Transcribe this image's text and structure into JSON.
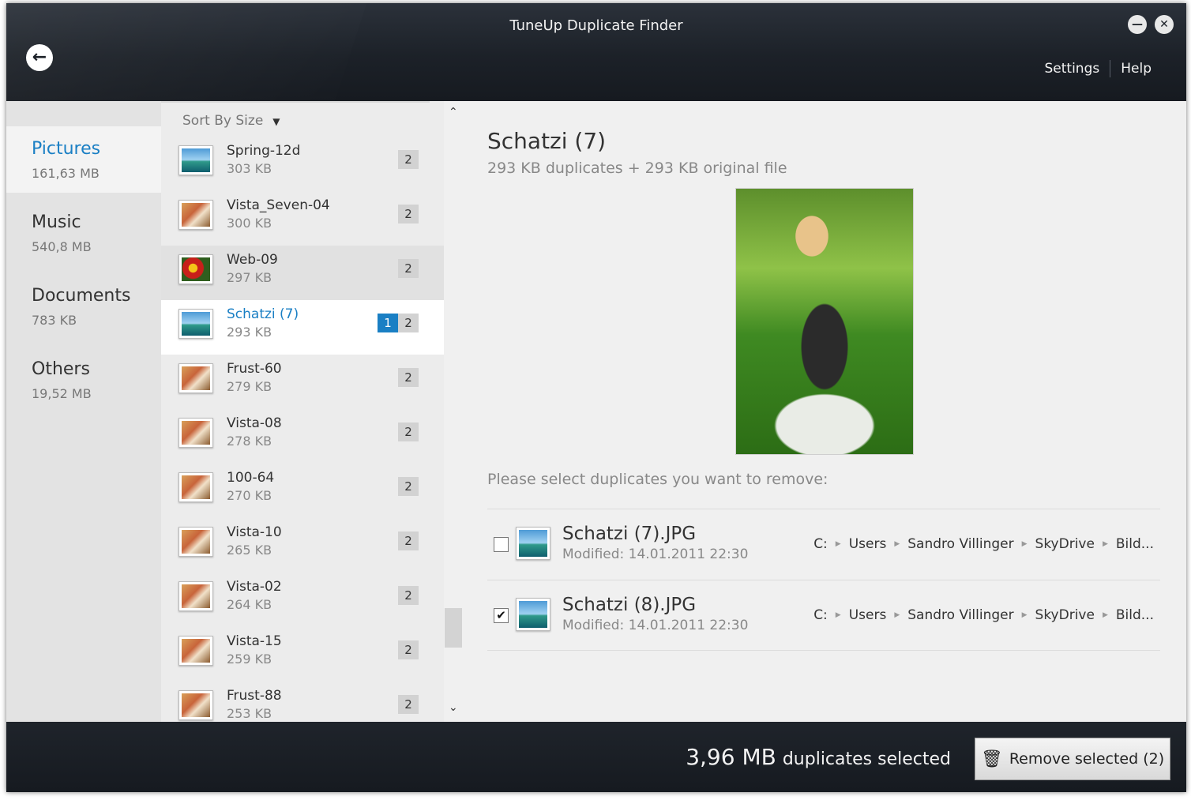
{
  "window": {
    "title": "TuneUp Duplicate Finder",
    "settings_label": "Settings",
    "help_label": "Help",
    "minimize_symbol": "—",
    "close_symbol": "✕",
    "back_symbol": "←"
  },
  "categories": [
    {
      "name": "Pictures",
      "size": "161,63 MB",
      "active": true
    },
    {
      "name": "Music",
      "size": "540,8 MB",
      "active": false
    },
    {
      "name": "Documents",
      "size": "783 KB",
      "active": false
    },
    {
      "name": "Others",
      "size": "19,52 MB",
      "active": false
    }
  ],
  "file_list": {
    "sort_label": "Sort By Size",
    "sort_arrow": "▼",
    "files": [
      {
        "name": "Spring-12d",
        "size": "303 KB",
        "count": "2",
        "selected_count": "",
        "icon": "landscape-icon"
      },
      {
        "name": "Vista_Seven-04",
        "size": "300 KB",
        "count": "2",
        "selected_count": "",
        "icon": "photo-icon"
      },
      {
        "name": "Web-09",
        "size": "297 KB",
        "count": "2",
        "selected_count": "",
        "icon": "flower-icon"
      },
      {
        "name": "Schatzi (7)",
        "size": "293 KB",
        "count": "2",
        "selected_count": "1",
        "icon": "landscape-icon"
      },
      {
        "name": "Frust-60",
        "size": "279 KB",
        "count": "2",
        "selected_count": "",
        "icon": "photo-icon"
      },
      {
        "name": "Vista-08",
        "size": "278 KB",
        "count": "2",
        "selected_count": "",
        "icon": "photo-icon"
      },
      {
        "name": "100-64",
        "size": "270 KB",
        "count": "2",
        "selected_count": "",
        "icon": "photo-icon"
      },
      {
        "name": "Vista-10",
        "size": "265 KB",
        "count": "2",
        "selected_count": "",
        "icon": "photo-icon"
      },
      {
        "name": "Vista-02",
        "size": "264 KB",
        "count": "2",
        "selected_count": "",
        "icon": "photo-icon"
      },
      {
        "name": "Vista-15",
        "size": "259 KB",
        "count": "2",
        "selected_count": "",
        "icon": "photo-icon"
      },
      {
        "name": "Frust-88",
        "size": "253 KB",
        "count": "2",
        "selected_count": "",
        "icon": "photo-icon"
      }
    ],
    "scroll_up": "⌃",
    "scroll_down": "⌄"
  },
  "detail": {
    "title": "Schatzi (7)",
    "subtitle": "293 KB duplicates + 293 KB original file",
    "prompt": "Please select duplicates you want to remove:",
    "duplicates": [
      {
        "name": "Schatzi (7).JPG",
        "modified": "Modified: 14.01.2011 22:30",
        "checked": false,
        "path": [
          "C:",
          "Users",
          "Sandro Villinger",
          "SkyDrive",
          "Bild..."
        ]
      },
      {
        "name": "Schatzi (8).JPG",
        "modified": "Modified: 14.01.2011 22:30",
        "checked": true,
        "path": [
          "C:",
          "Users",
          "Sandro Villinger",
          "SkyDrive",
          "Bild..."
        ]
      }
    ],
    "check_mark": "✔",
    "path_separator": "▶"
  },
  "footer": {
    "amount": "3,96 MB",
    "amount_suffix": "duplicates selected",
    "remove_label": "Remove selected (2)"
  }
}
